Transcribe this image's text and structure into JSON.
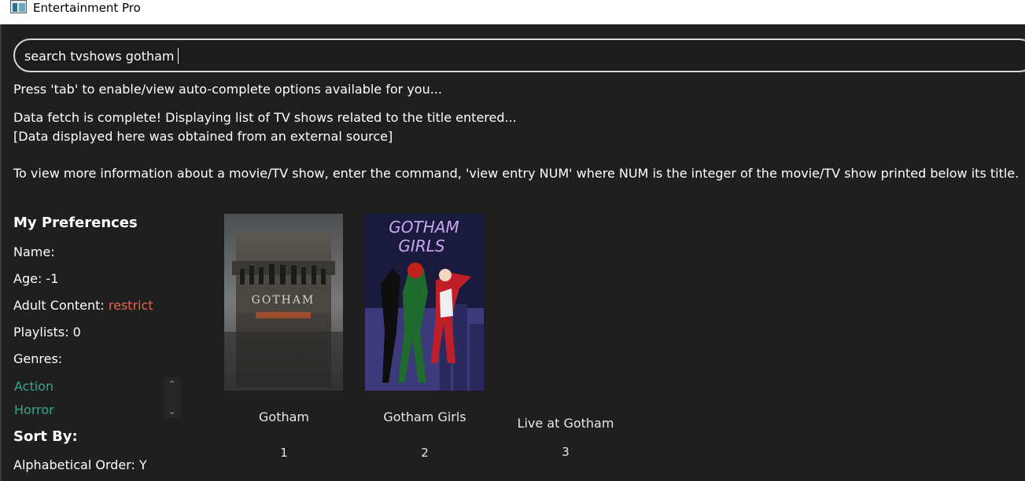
{
  "window": {
    "title": "Entertainment Pro"
  },
  "search": {
    "value": "search tvshows gotham"
  },
  "messages": {
    "tab_hint": "Press 'tab' to enable/view auto-complete options available for you...",
    "fetch_complete": "Data fetch is complete! Displaying list of TV shows related to the title entered...",
    "source_note": "[Data displayed here was obtained from an external source]",
    "instructions": "To view more information about a movie/TV show, enter the command, 'view entry NUM' where NUM is the integer of the movie/TV show printed below its title."
  },
  "preferences": {
    "heading": "My Preferences",
    "name_label": "Name:",
    "age_label": "Age: -1",
    "adult_label": "Adult Content:",
    "adult_value": "restrict",
    "playlists_label": "Playlists: 0",
    "genres_label": "Genres:",
    "genres": [
      "Action",
      "Horror"
    ],
    "sort_heading": "Sort By:",
    "alpha_order": "Alphabetical Order: Y"
  },
  "results": [
    {
      "title": "Gotham",
      "number": "1",
      "poster_text": "GOTHAM"
    },
    {
      "title": "Gotham Girls",
      "number": "2",
      "poster_text": [
        "GOTHAM",
        "GIRLS"
      ]
    },
    {
      "title": "Live at Gotham",
      "number": "3"
    }
  ],
  "colors": {
    "background": "#1f1f1f",
    "accent_restrict": "#e0684c",
    "genre_text": "#3aa58a"
  }
}
